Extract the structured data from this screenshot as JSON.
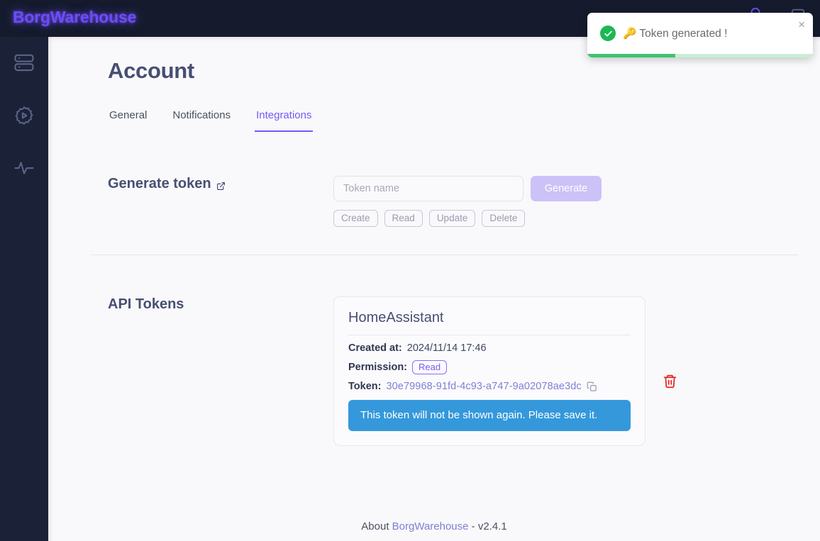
{
  "app": {
    "logo": "BorgWarehouse"
  },
  "topbar": {
    "icons": [
      {
        "name": "notification-bell-icon"
      },
      {
        "name": "user-account-icon"
      }
    ]
  },
  "sidebar": {
    "items": [
      {
        "name": "sidebar-item-repositories",
        "icon": "server-icon"
      },
      {
        "name": "sidebar-item-settings",
        "icon": "gear-play-icon"
      },
      {
        "name": "sidebar-item-status",
        "icon": "activity-pulse-icon"
      }
    ]
  },
  "page": {
    "title": "Account"
  },
  "tabs": [
    {
      "label": "General",
      "active": false
    },
    {
      "label": "Notifications",
      "active": false
    },
    {
      "label": "Integrations",
      "active": true
    }
  ],
  "generate": {
    "section_label": "Generate token",
    "external_link_icon": "external-link-icon",
    "input_placeholder": "Token name",
    "input_value": "",
    "button_label": "Generate",
    "button_disabled": true,
    "permissions": [
      "Create",
      "Read",
      "Update",
      "Delete"
    ]
  },
  "api_tokens": {
    "section_label": "API Tokens",
    "card": {
      "title": "HomeAssistant",
      "created_at_label": "Created at:",
      "created_at_value": "2024/11/14 17:46",
      "permission_label": "Permission:",
      "permission_value": "Read",
      "token_label": "Token:",
      "token_value": "30e79968-91fd-4c93-a747-9a02078ae3dc",
      "copy_icon": "copy-icon",
      "warning": "This token will not be shown again. Please save it.",
      "delete_icon": "trash-icon"
    }
  },
  "footer": {
    "about_text": "About",
    "link_text": "BorgWarehouse",
    "version_text": "- v2.4.1"
  },
  "toast": {
    "message": "🔑 Token generated !",
    "close_label": "×",
    "status_icon": "check-circle-icon",
    "progress_percent": 39
  },
  "colors": {
    "brand_purple": "#6c4df6",
    "accent_purple": "#7858f5",
    "sidebar_bg": "#1b2237",
    "topbar_bg": "#151b2c",
    "content_bg": "#f9f9fb",
    "info_blue": "#3498db",
    "danger_red": "#e52421",
    "success_green": "#1cb854"
  }
}
